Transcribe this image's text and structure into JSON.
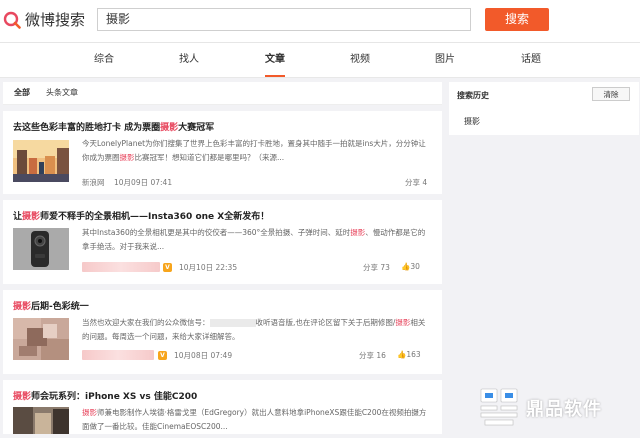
{
  "header": {
    "logo_text": "微博搜索",
    "search_value": "摄影",
    "search_button": "搜索"
  },
  "tabs": [
    {
      "label": "综合",
      "active": false
    },
    {
      "label": "找人",
      "active": false
    },
    {
      "label": "文章",
      "active": true
    },
    {
      "label": "视频",
      "active": false
    },
    {
      "label": "图片",
      "active": false
    },
    {
      "label": "话题",
      "active": false
    }
  ],
  "subtabs": [
    {
      "label": "全部",
      "active": true
    },
    {
      "label": "头条文章",
      "active": false
    }
  ],
  "articles": [
    {
      "title_pre": "去这些色彩丰富的胜地打卡 成为票圈",
      "title_hl": "摄影",
      "title_post": "大赛冠军",
      "excerpt_line1_pre": "今天LonelyPlanet为你们搜集了世界上色彩丰富的打卡胜地，置身其中随手一拍就是ins大片，分分钟让",
      "excerpt_line2_pre": "你成为票圈",
      "excerpt_line2_hl": "摄影",
      "excerpt_line2_post": "比赛冠军！想知道它们都是哪里吗？（来源...",
      "source": "新浪网",
      "date": "10月09日 07:41",
      "share": "分享 4"
    },
    {
      "title_pre": "让",
      "title_hl": "摄影",
      "title_post": "师爱不释手的全景相机——Insta360 one X全新发布！",
      "excerpt_line1_pre": "其中Insta360的全景相机更是其中的佼佼者——360°全景拍摄、子弹时间、延时",
      "excerpt_line1_hl": "摄影",
      "excerpt_line1_post": "、慢动作都是它的",
      "excerpt_line2": "拿手绝活。对于我来说...",
      "verified": "V",
      "date": "10月10日 22:35",
      "share": "分享 73",
      "likes": "30"
    },
    {
      "title_pre": "",
      "title_hl": "摄影",
      "title_post": "后期-色彩统一",
      "excerpt_line1_pre": "当然也欢迎大家在我们的公众微信号：",
      "excerpt_line1_mid": "收听语音版,也在评论区留下关于后期修图/",
      "excerpt_line1_hl": "摄影",
      "excerpt_line1_post": "相关",
      "excerpt_line2": "的问题。每周选一个问题，来给大家详细解答。",
      "verified": "V",
      "date": "10月08日 07:49",
      "share": "分享 16",
      "likes": "163"
    },
    {
      "title_pre": "",
      "title_hl": "摄影",
      "title_post": "师会玩系列：iPhone XS vs 佳能C200",
      "excerpt_line1_hl": "摄影",
      "excerpt_line1_post": "师兼电影制作人埃德·格雷戈里（EdGregory）就出人意料地拿iPhoneXS跟佳能C200在视频拍摄方",
      "excerpt_line2": "面做了一番比较。佳能CinemaEOSC200..."
    }
  ],
  "sidebar": {
    "title": "搜索历史",
    "clear_button": "清除",
    "history": [
      "摄影"
    ]
  },
  "watermark": {
    "text": "鼎品软件"
  },
  "colors": {
    "accent": "#f25a2a",
    "highlight": "#e8485f",
    "verified": "#f7a51c"
  }
}
